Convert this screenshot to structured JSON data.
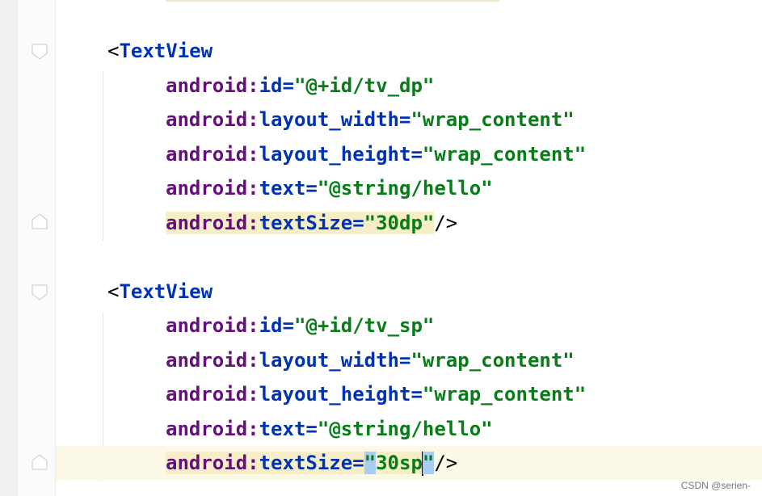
{
  "block1": {
    "open": "<",
    "tag": "TextView",
    "attrs": [
      {
        "ns": "android",
        "colon": ":",
        "name": "id",
        "eq": "=",
        "value": "\"@+id/tv_dp\""
      },
      {
        "ns": "android",
        "colon": ":",
        "name": "layout_width",
        "eq": "=",
        "value": "\"wrap_content\""
      },
      {
        "ns": "android",
        "colon": ":",
        "name": "layout_height",
        "eq": "=",
        "value": "\"wrap_content\""
      },
      {
        "ns": "android",
        "colon": ":",
        "name": "text",
        "eq": "=",
        "value": "\"@string/hello\""
      },
      {
        "ns": "android",
        "colon": ":",
        "name": "textSize",
        "eq": "=",
        "value": "\"30dp\"",
        "close": "/>"
      }
    ]
  },
  "block2": {
    "open": "<",
    "tag": "TextView",
    "attrs": [
      {
        "ns": "android",
        "colon": ":",
        "name": "id",
        "eq": "=",
        "value": "\"@+id/tv_sp\""
      },
      {
        "ns": "android",
        "colon": ":",
        "name": "layout_width",
        "eq": "=",
        "value": "\"wrap_content\""
      },
      {
        "ns": "android",
        "colon": ":",
        "name": "layout_height",
        "eq": "=",
        "value": "\"wrap_content\""
      },
      {
        "ns": "android",
        "colon": ":",
        "name": "text",
        "eq": "=",
        "value": "\"@string/hello\""
      },
      {
        "ns": "android",
        "colon": ":",
        "name": "textSize",
        "eq": "=",
        "quote_open": "\"",
        "value_inner": "30sp",
        "quote_close": "\"",
        "close": "/>"
      }
    ]
  },
  "watermark": "CSDN @serien-",
  "colors": {
    "namespace": "#660e7a",
    "attribute": "#0033b3",
    "string_value": "#067d17",
    "tag": "#0033b3",
    "current_line": "#fcf9e6",
    "attr_highlight": "#f5eec6",
    "brace_match": "#a8cdf0"
  }
}
